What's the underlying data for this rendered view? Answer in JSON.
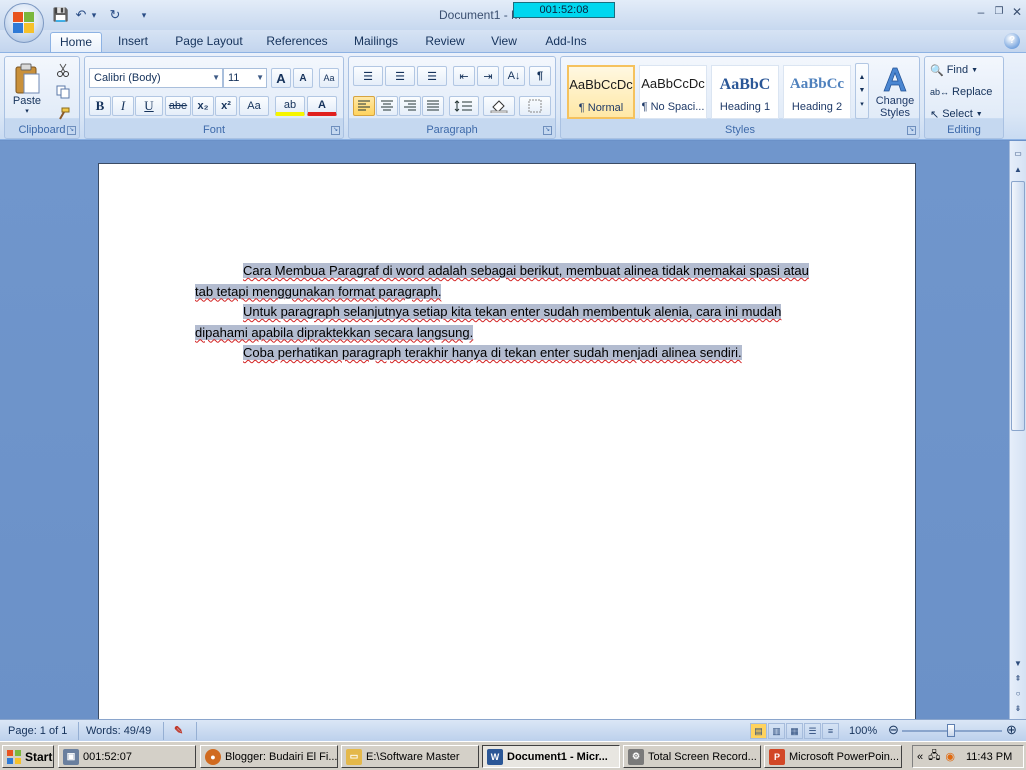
{
  "window": {
    "title": "Document1 - M",
    "timer_overlay": "001:52:08",
    "controls": {
      "minimize": "–",
      "restore": "❐",
      "close": "✕"
    }
  },
  "qat": {
    "save": "💾",
    "undo": "↶",
    "undo_arrow": "▾",
    "redo": "↻",
    "customize": "▾"
  },
  "tabs": [
    {
      "label": "Home",
      "active": true
    },
    {
      "label": "Insert"
    },
    {
      "label": "Page Layout"
    },
    {
      "label": "References"
    },
    {
      "label": "Mailings"
    },
    {
      "label": "Review"
    },
    {
      "label": "View"
    },
    {
      "label": "Add-Ins"
    }
  ],
  "help": "?",
  "ribbon": {
    "clipboard": {
      "label": "Clipboard",
      "paste": "Paste",
      "paste_arrow": "▾"
    },
    "font": {
      "label": "Font",
      "family": "Calibri (Body)",
      "size": "11",
      "grow": "A",
      "shrink": "A",
      "clear": "Aa",
      "bold": "B",
      "italic": "I",
      "underline": "U",
      "strike": "abe",
      "subscript": "x₂",
      "superscript": "x²",
      "change_case": "Aa",
      "highlight": "ab",
      "font_color": "A"
    },
    "paragraph": {
      "label": "Paragraph",
      "bullets": "☰",
      "numbering": "☰",
      "multilevel": "☰",
      "decrease_indent": "⇤",
      "increase_indent": "⇥",
      "sort": "A↓",
      "pilcrow": "¶"
    },
    "styles": {
      "label": "Styles",
      "items": [
        {
          "preview": "AaBbCcDc",
          "name": "¶ Normal",
          "selected": true
        },
        {
          "preview": "AaBbCcDc",
          "name": "¶ No Spaci..."
        },
        {
          "preview": "AaBbC",
          "name": "Heading 1"
        },
        {
          "preview": "AaBbCc",
          "name": "Heading 2"
        }
      ],
      "change_styles": "Change Styles"
    },
    "editing": {
      "label": "Editing",
      "find": "Find",
      "replace": "Replace",
      "select": "Select"
    }
  },
  "document": {
    "paragraphs": [
      "Cara Membua Paragraf di word adalah sebagai berikut, membuat alinea tidak memakai spasi atau tab tetapi menggunakan format paragraph.",
      "Untuk paragraph selanjutnya setiap kita tekan enter sudah membentuk alenia, cara ini mudah dipahami apabila dipraktekkan secara langsung.",
      "Coba perhatikan paragraph terakhir hanya di tekan enter sudah menjadi alinea sendiri."
    ]
  },
  "statusbar": {
    "page": "Page: 1 of 1",
    "words": "Words: 49/49",
    "zoom": "100%"
  },
  "taskbar": {
    "start": "Start",
    "tasks": [
      {
        "label": "001:52:07",
        "icon_color": "#6a7f9e"
      },
      {
        "label": "Blogger: Budairi El Fi...",
        "icon_color": "#d06a1f"
      },
      {
        "label": "E:\\Software Master",
        "icon_color": "#e4b84a"
      },
      {
        "label": "Document1 - Micr...",
        "icon_color": "#2b5797",
        "active": true
      },
      {
        "label": "Total Screen Record...",
        "icon_color": "#7a7a7a"
      },
      {
        "label": "Microsoft PowerPoin...",
        "icon_color": "#d24726"
      }
    ],
    "tray_time": "11:43 PM",
    "tray_expand": "«"
  },
  "colors": {
    "ribbon_bg": "#dbe7f6",
    "selection": "#b3bcd0",
    "doc_bg": "#6b91c8",
    "timer_bg": "#00d7ef"
  }
}
